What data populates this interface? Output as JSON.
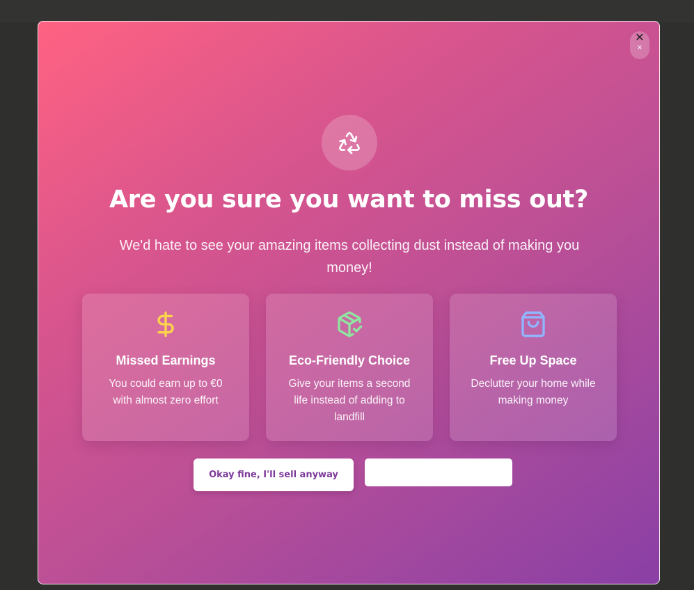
{
  "modal": {
    "close_dark": "✕",
    "close_light": "×",
    "hero_icon": "recycle-icon",
    "title": "Are you sure you want to miss out?",
    "subtitle": "We'd hate to see your amazing items collecting dust instead of making you money!"
  },
  "cards": [
    {
      "icon": "dollar-icon",
      "icon_color": "#ffd44d",
      "title": "Missed Earnings",
      "description": "You could earn up to €0 with almost zero effort"
    },
    {
      "icon": "package-check-icon",
      "icon_color": "#8fe6a0",
      "title": "Eco-Friendly Choice",
      "description": "Give your items a second life instead of adding to landfill"
    },
    {
      "icon": "shopping-bag-icon",
      "icon_color": "#8fb6ff",
      "title": "Free Up Space",
      "description": "Declutter your home while making money"
    }
  ],
  "actions": {
    "sell_label": "Okay fine, I'll sell anyway",
    "secondary_label": ""
  },
  "colors": {
    "gradient_start": "#ff6282",
    "gradient_end": "#8a3fa5",
    "button_text": "#7c3a9a"
  }
}
